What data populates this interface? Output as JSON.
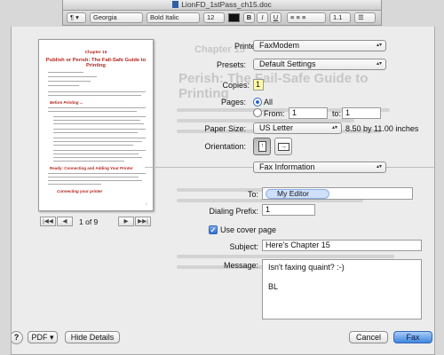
{
  "window": {
    "title": "LionFD_1stPass_ch15.doc"
  },
  "toolbar": {
    "style_popup": "¶",
    "font_popup": "Georgia",
    "typeface_popup": "Bold Italic",
    "size_popup": "12",
    "bold": "B",
    "italic": "I",
    "underline": "U",
    "spacing_popup": "1.1"
  },
  "preview": {
    "chapter": "Chapter 15",
    "title": "Publish or Perish: The Fail-Safe Guide to Printing",
    "heading1": "Before Printing ...",
    "heading2": "Ready: Connecting and Adding Your Printer",
    "heading3": "Connecting your printer",
    "page_indicator": "1 of 9"
  },
  "ghost": {
    "chapter": "Chapter 15",
    "title": "Perish: The Fail-Safe Guide to Printing"
  },
  "print": {
    "printer_label": "Printer:",
    "printer_value": "FaxModem",
    "presets_label": "Presets:",
    "presets_value": "Default Settings",
    "copies_label": "Copies:",
    "copies_value": "1",
    "pages_label": "Pages:",
    "pages_all": "All",
    "pages_from": "From:",
    "from_value": "1",
    "pages_to": "to:",
    "to_value": "1",
    "paper_label": "Paper Size:",
    "paper_value": "US Letter",
    "paper_dims": "8.50 by 11.00 inches",
    "orientation_label": "Orientation:",
    "section_value": "Fax Information"
  },
  "fax": {
    "to_label": "To:",
    "recipient": "My Editor",
    "dialing_label": "Dialing Prefix:",
    "dialing_value": "1",
    "cover_label": "Use cover page",
    "subject_label": "Subject:",
    "subject_value": "Here's Chapter 15",
    "message_label": "Message:",
    "message_lines": [
      "Isn't faxing quaint?  :-)",
      "",
      "BL"
    ]
  },
  "footer": {
    "help": "?",
    "pdf": "PDF",
    "hide_details": "Hide Details",
    "cancel": "Cancel",
    "fax": "Fax"
  }
}
